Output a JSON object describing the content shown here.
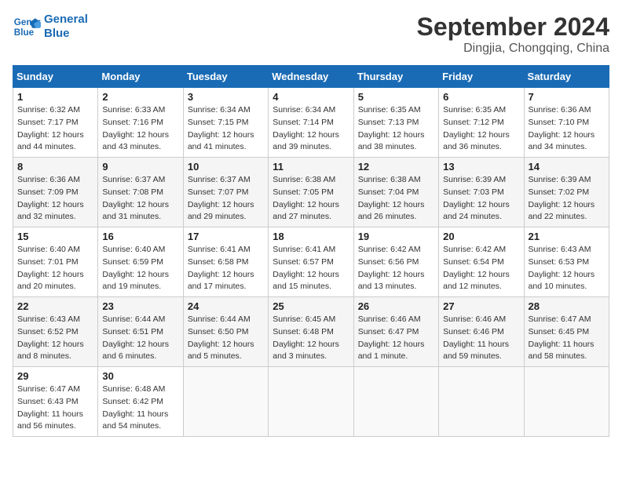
{
  "header": {
    "logo_line1": "General",
    "logo_line2": "Blue",
    "month": "September 2024",
    "location": "Dingjia, Chongqing, China"
  },
  "weekdays": [
    "Sunday",
    "Monday",
    "Tuesday",
    "Wednesday",
    "Thursday",
    "Friday",
    "Saturday"
  ],
  "weeks": [
    [
      {
        "day": "1",
        "info": "Sunrise: 6:32 AM\nSunset: 7:17 PM\nDaylight: 12 hours\nand 44 minutes."
      },
      {
        "day": "2",
        "info": "Sunrise: 6:33 AM\nSunset: 7:16 PM\nDaylight: 12 hours\nand 43 minutes."
      },
      {
        "day": "3",
        "info": "Sunrise: 6:34 AM\nSunset: 7:15 PM\nDaylight: 12 hours\nand 41 minutes."
      },
      {
        "day": "4",
        "info": "Sunrise: 6:34 AM\nSunset: 7:14 PM\nDaylight: 12 hours\nand 39 minutes."
      },
      {
        "day": "5",
        "info": "Sunrise: 6:35 AM\nSunset: 7:13 PM\nDaylight: 12 hours\nand 38 minutes."
      },
      {
        "day": "6",
        "info": "Sunrise: 6:35 AM\nSunset: 7:12 PM\nDaylight: 12 hours\nand 36 minutes."
      },
      {
        "day": "7",
        "info": "Sunrise: 6:36 AM\nSunset: 7:10 PM\nDaylight: 12 hours\nand 34 minutes."
      }
    ],
    [
      {
        "day": "8",
        "info": "Sunrise: 6:36 AM\nSunset: 7:09 PM\nDaylight: 12 hours\nand 32 minutes."
      },
      {
        "day": "9",
        "info": "Sunrise: 6:37 AM\nSunset: 7:08 PM\nDaylight: 12 hours\nand 31 minutes."
      },
      {
        "day": "10",
        "info": "Sunrise: 6:37 AM\nSunset: 7:07 PM\nDaylight: 12 hours\nand 29 minutes."
      },
      {
        "day": "11",
        "info": "Sunrise: 6:38 AM\nSunset: 7:05 PM\nDaylight: 12 hours\nand 27 minutes."
      },
      {
        "day": "12",
        "info": "Sunrise: 6:38 AM\nSunset: 7:04 PM\nDaylight: 12 hours\nand 26 minutes."
      },
      {
        "day": "13",
        "info": "Sunrise: 6:39 AM\nSunset: 7:03 PM\nDaylight: 12 hours\nand 24 minutes."
      },
      {
        "day": "14",
        "info": "Sunrise: 6:39 AM\nSunset: 7:02 PM\nDaylight: 12 hours\nand 22 minutes."
      }
    ],
    [
      {
        "day": "15",
        "info": "Sunrise: 6:40 AM\nSunset: 7:01 PM\nDaylight: 12 hours\nand 20 minutes."
      },
      {
        "day": "16",
        "info": "Sunrise: 6:40 AM\nSunset: 6:59 PM\nDaylight: 12 hours\nand 19 minutes."
      },
      {
        "day": "17",
        "info": "Sunrise: 6:41 AM\nSunset: 6:58 PM\nDaylight: 12 hours\nand 17 minutes."
      },
      {
        "day": "18",
        "info": "Sunrise: 6:41 AM\nSunset: 6:57 PM\nDaylight: 12 hours\nand 15 minutes."
      },
      {
        "day": "19",
        "info": "Sunrise: 6:42 AM\nSunset: 6:56 PM\nDaylight: 12 hours\nand 13 minutes."
      },
      {
        "day": "20",
        "info": "Sunrise: 6:42 AM\nSunset: 6:54 PM\nDaylight: 12 hours\nand 12 minutes."
      },
      {
        "day": "21",
        "info": "Sunrise: 6:43 AM\nSunset: 6:53 PM\nDaylight: 12 hours\nand 10 minutes."
      }
    ],
    [
      {
        "day": "22",
        "info": "Sunrise: 6:43 AM\nSunset: 6:52 PM\nDaylight: 12 hours\nand 8 minutes."
      },
      {
        "day": "23",
        "info": "Sunrise: 6:44 AM\nSunset: 6:51 PM\nDaylight: 12 hours\nand 6 minutes."
      },
      {
        "day": "24",
        "info": "Sunrise: 6:44 AM\nSunset: 6:50 PM\nDaylight: 12 hours\nand 5 minutes."
      },
      {
        "day": "25",
        "info": "Sunrise: 6:45 AM\nSunset: 6:48 PM\nDaylight: 12 hours\nand 3 minutes."
      },
      {
        "day": "26",
        "info": "Sunrise: 6:46 AM\nSunset: 6:47 PM\nDaylight: 12 hours\nand 1 minute."
      },
      {
        "day": "27",
        "info": "Sunrise: 6:46 AM\nSunset: 6:46 PM\nDaylight: 11 hours\nand 59 minutes."
      },
      {
        "day": "28",
        "info": "Sunrise: 6:47 AM\nSunset: 6:45 PM\nDaylight: 11 hours\nand 58 minutes."
      }
    ],
    [
      {
        "day": "29",
        "info": "Sunrise: 6:47 AM\nSunset: 6:43 PM\nDaylight: 11 hours\nand 56 minutes."
      },
      {
        "day": "30",
        "info": "Sunrise: 6:48 AM\nSunset: 6:42 PM\nDaylight: 11 hours\nand 54 minutes."
      },
      {
        "day": "",
        "info": ""
      },
      {
        "day": "",
        "info": ""
      },
      {
        "day": "",
        "info": ""
      },
      {
        "day": "",
        "info": ""
      },
      {
        "day": "",
        "info": ""
      }
    ]
  ]
}
